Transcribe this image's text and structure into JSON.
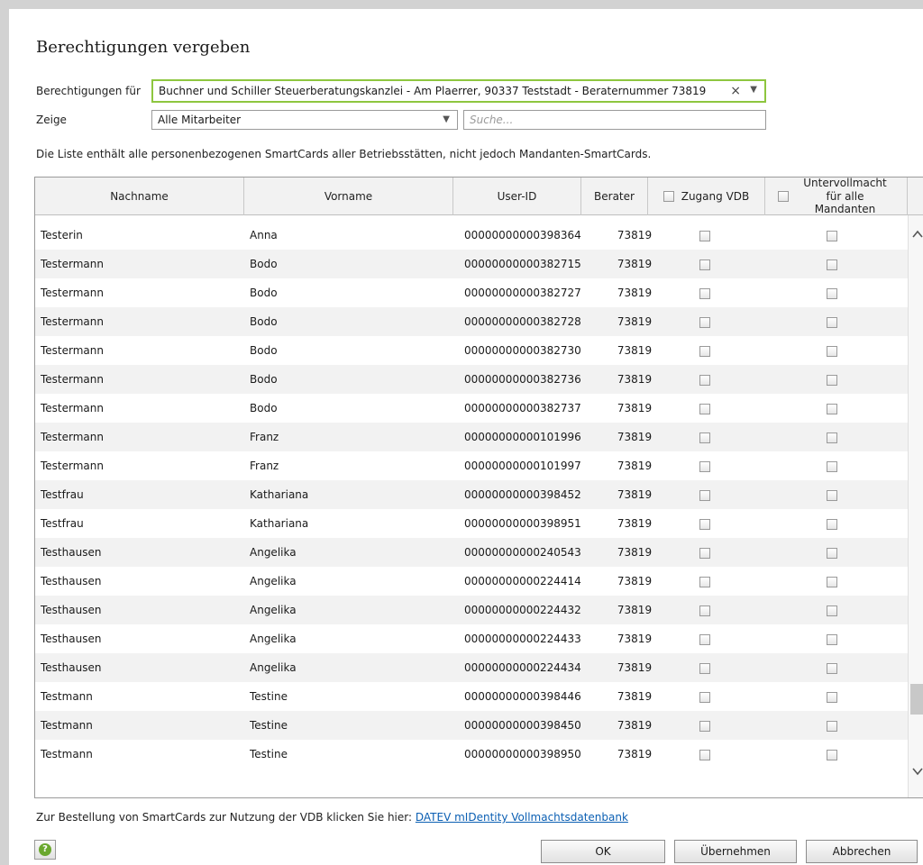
{
  "dialog": {
    "title": "Berechtigungen vergeben",
    "for_label": "Berechtigungen für",
    "for_value": "Buchner und Schiller Steuerberatungskanzlei  - Am Plaerrer, 90337 Teststadt - Beraternummer 73819",
    "show_label": "Zeige",
    "show_value": "Alle Mitarbeiter",
    "search_placeholder": "Suche...",
    "info_text": "Die Liste enthält alle personenbezogenen SmartCards aller Betriebsstätten, nicht jedoch Mandanten-SmartCards."
  },
  "table": {
    "headers": {
      "nachname": "Nachname",
      "vorname": "Vorname",
      "user_id": "User-ID",
      "berater": "Berater",
      "zugang_vdb": "Zugang VDB",
      "untervollmacht": "Untervollmacht für alle Mandanten"
    },
    "rows": [
      {
        "nachname": "Testerin",
        "vorname": "Anna",
        "user_id": "00000000000398364",
        "berater": "73819"
      },
      {
        "nachname": "Testermann",
        "vorname": "Bodo",
        "user_id": "00000000000382715",
        "berater": "73819"
      },
      {
        "nachname": "Testermann",
        "vorname": "Bodo",
        "user_id": "00000000000382727",
        "berater": "73819"
      },
      {
        "nachname": "Testermann",
        "vorname": "Bodo",
        "user_id": "00000000000382728",
        "berater": "73819"
      },
      {
        "nachname": "Testermann",
        "vorname": "Bodo",
        "user_id": "00000000000382730",
        "berater": "73819"
      },
      {
        "nachname": "Testermann",
        "vorname": "Bodo",
        "user_id": "00000000000382736",
        "berater": "73819"
      },
      {
        "nachname": "Testermann",
        "vorname": "Bodo",
        "user_id": "00000000000382737",
        "berater": "73819"
      },
      {
        "nachname": "Testermann",
        "vorname": "Franz",
        "user_id": "00000000000101996",
        "berater": "73819"
      },
      {
        "nachname": "Testermann",
        "vorname": "Franz",
        "user_id": "00000000000101997",
        "berater": "73819"
      },
      {
        "nachname": "Testfrau",
        "vorname": "Kathariana",
        "user_id": "00000000000398452",
        "berater": "73819"
      },
      {
        "nachname": "Testfrau",
        "vorname": "Kathariana",
        "user_id": "00000000000398951",
        "berater": "73819"
      },
      {
        "nachname": "Testhausen",
        "vorname": "Angelika",
        "user_id": "00000000000240543",
        "berater": "73819"
      },
      {
        "nachname": "Testhausen",
        "vorname": "Angelika",
        "user_id": "00000000000224414",
        "berater": "73819"
      },
      {
        "nachname": "Testhausen",
        "vorname": "Angelika",
        "user_id": "00000000000224432",
        "berater": "73819"
      },
      {
        "nachname": "Testhausen",
        "vorname": "Angelika",
        "user_id": "00000000000224433",
        "berater": "73819"
      },
      {
        "nachname": "Testhausen",
        "vorname": "Angelika",
        "user_id": "00000000000224434",
        "berater": "73819"
      },
      {
        "nachname": "Testmann",
        "vorname": "Testine",
        "user_id": "00000000000398446",
        "berater": "73819"
      },
      {
        "nachname": "Testmann",
        "vorname": "Testine",
        "user_id": "00000000000398450",
        "berater": "73819"
      },
      {
        "nachname": "Testmann",
        "vorname": "Testine",
        "user_id": "00000000000398950",
        "berater": "73819"
      }
    ]
  },
  "footer": {
    "order_text": "Zur Bestellung von SmartCards zur Nutzung der VDB klicken Sie hier:",
    "order_link": "DATEV mIDentity Vollmachtsdatenbank",
    "ok_label": "OK",
    "apply_label": "Übernehmen",
    "cancel_label": "Abbrechen"
  },
  "icons": {
    "help": "help-icon",
    "clear": "clear-icon",
    "dropdown": "chevron-down-icon",
    "scroll_up": "chevron-up-icon",
    "scroll_down": "chevron-down-icon"
  },
  "colors": {
    "focus_border": "#8ec63f",
    "link": "#0b5fb3",
    "help_icon": "#6aa82e"
  }
}
